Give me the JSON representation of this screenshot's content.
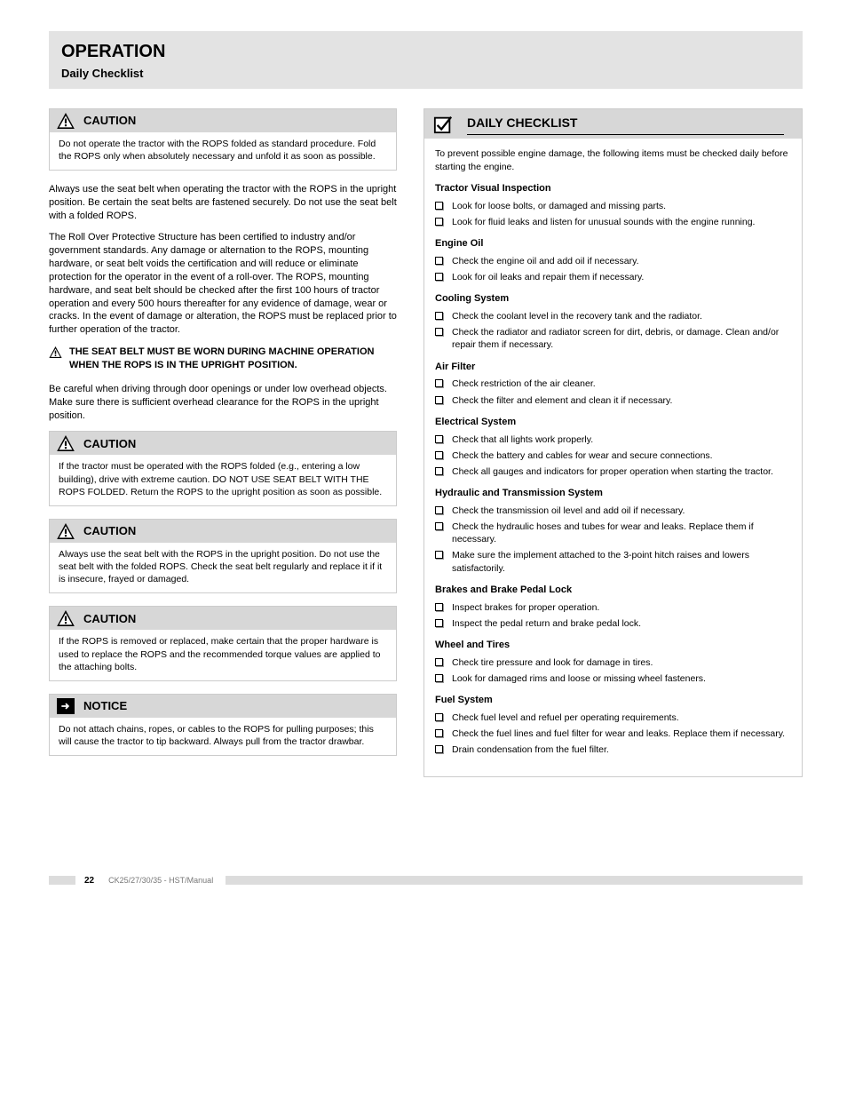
{
  "title": {
    "main": "OPERATION",
    "sub": "Daily Checklist"
  },
  "left": {
    "callout1": {
      "label": "CAUTION",
      "body": "Do not operate the tractor with the ROPS folded as standard procedure. Fold the ROPS only when absolutely necessary and unfold it as soon as possible."
    },
    "para1": "Always use the seat belt when operating the tractor with the ROPS in the upright position. Be certain the seat belts are fastened securely. Do not use the seat belt with a folded ROPS.",
    "para2": "The Roll Over Protective Structure has been certified to industry and/or government standards. Any damage or alternation to the ROPS, mounting hardware, or seat belt voids the certification and will reduce or eliminate protection for the operator in the event of a roll-over. The ROPS, mounting hardware, and seat belt should be checked after the first 100 hours of tractor operation and every 500 hours thereafter for any evidence of damage, wear or cracks. In the event of damage or alteration, the ROPS must be replaced prior to further operation of the tractor.",
    "inlineWarn": "THE SEAT BELT MUST BE WORN DURING MACHINE OPERATION WHEN THE ROPS IS IN THE UPRIGHT POSITION.",
    "para3": "Be careful when driving through door openings or under low overhead objects. Make sure there is sufficient overhead clearance for the ROPS in the upright position.",
    "callout2": {
      "label": "CAUTION",
      "body": "If the tractor must be operated with the ROPS folded (e.g., entering a low building), drive with extreme caution. DO NOT USE SEAT BELT WITH THE ROPS FOLDED. Return the ROPS to the upright position as soon as possible."
    },
    "callout3": {
      "label": "CAUTION",
      "body": "Always use the seat belt with the ROPS in the upright position. Do not use the seat belt with the folded ROPS. Check the seat belt regularly and replace it if it is insecure, frayed or damaged."
    },
    "callout4": {
      "label": "CAUTION",
      "body": "If the ROPS is removed or replaced, make certain that the proper hardware is used to replace the ROPS and the recommended torque values are applied to the attaching bolts."
    },
    "callout5": {
      "label": "NOTICE",
      "body": "Do not attach chains, ropes, or cables to the ROPS for pulling purposes; this will cause the tractor to tip backward. Always pull from the tractor drawbar."
    }
  },
  "checklist": {
    "title": "DAILY CHECKLIST",
    "note": "To prevent possible engine damage, the following items must be checked daily before starting the engine.",
    "sections": [
      {
        "title": "Tractor Visual Inspection",
        "items": [
          "Look for loose bolts, or damaged and missing parts.",
          "Look for fluid leaks and listen for unusual sounds with the engine running."
        ]
      },
      {
        "title": "Engine Oil",
        "items": [
          "Check the engine oil and add oil if necessary.",
          "Look for oil leaks and repair them if necessary."
        ]
      },
      {
        "title": "Cooling System",
        "items": [
          "Check the coolant level in the recovery tank and the radiator.",
          "Check the radiator and radiator screen for dirt, debris, or damage. Clean and/or repair them if necessary."
        ]
      },
      {
        "title": "Air Filter",
        "items": [
          "Check restriction of the air cleaner.",
          "Check the filter and element and clean it if necessary."
        ]
      },
      {
        "title": "Electrical System",
        "items": [
          "Check that all lights work properly.",
          "Check the battery and cables for wear and secure connections.",
          "Check all gauges and indicators for proper operation when starting the tractor."
        ]
      },
      {
        "title": "Hydraulic and Transmission System",
        "items": [
          "Check the transmission oil level and add oil if necessary.",
          "Check the hydraulic hoses and tubes for wear and leaks. Replace them if necessary.",
          "Make sure the implement attached to the 3-point hitch raises and lowers satisfactorily."
        ]
      },
      {
        "title": "Brakes and Brake Pedal Lock",
        "items": [
          "Inspect brakes for proper operation.",
          "Inspect the pedal return and brake pedal lock."
        ]
      },
      {
        "title": "Wheel and Tires",
        "items": [
          "Check tire pressure and look for damage in tires.",
          "Look for damaged rims and loose or missing wheel fasteners."
        ]
      },
      {
        "title": "Fuel System",
        "items": [
          "Check fuel level and refuel per operating requirements.",
          "Check the fuel lines and fuel filter for wear and leaks. Replace them if necessary.",
          "Drain condensation from the fuel filter."
        ]
      }
    ]
  },
  "footer": {
    "page": "22",
    "text": "CK25/27/30/35 - HST/Manual"
  }
}
